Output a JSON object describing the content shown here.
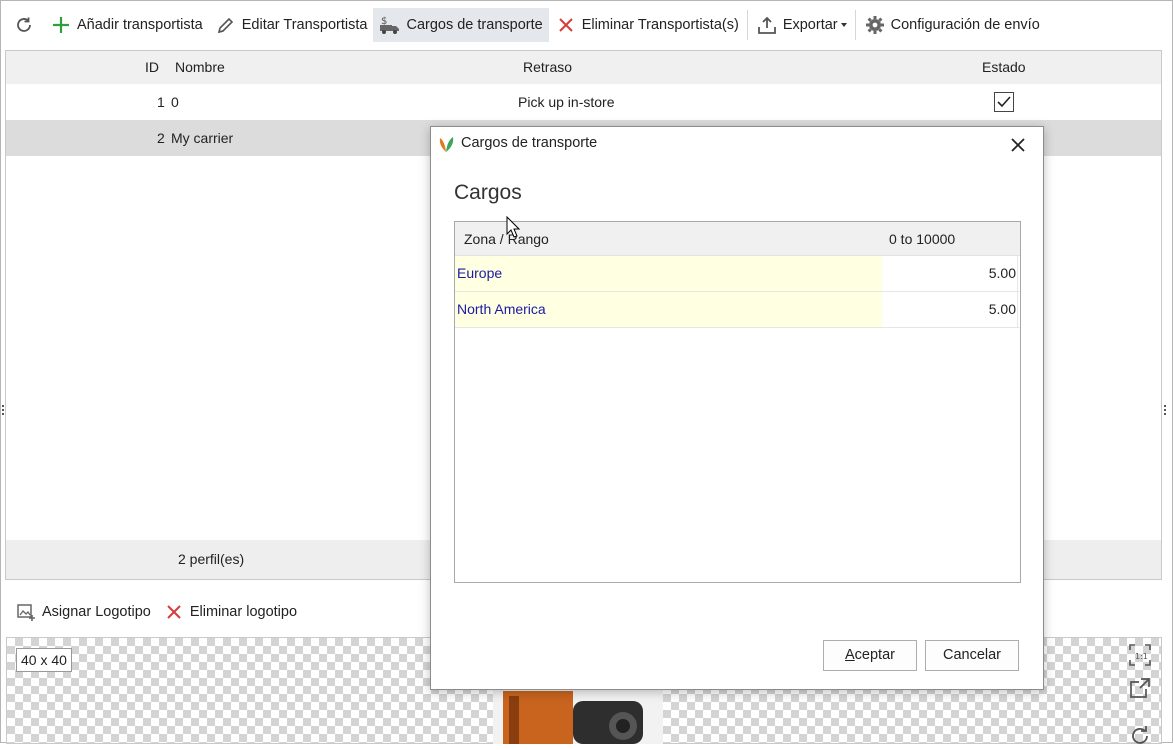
{
  "toolbar": {
    "items": [
      {
        "label": "",
        "icon": "refresh-icon"
      },
      {
        "label": "Añadir transportista",
        "icon": "plus-icon"
      },
      {
        "label": "Editar Transportista",
        "icon": "pencil-icon"
      },
      {
        "label": "Cargos de transporte",
        "icon": "shipping-charges-icon",
        "active": true
      },
      {
        "label": "Eliminar Transportista(s)",
        "icon": "close-icon"
      },
      {
        "label": "Exportar",
        "icon": "export-icon"
      },
      {
        "label": "Configuración de envío",
        "icon": "gear-icon"
      }
    ]
  },
  "grid": {
    "columns": {
      "id": "ID",
      "nombre": "Nombre",
      "retraso": "Retraso",
      "estado": "Estado"
    },
    "rows": [
      {
        "id": "1",
        "nombre": "0",
        "retraso": "Pick up in-store",
        "estado": true
      },
      {
        "id": "2",
        "nombre": "My carrier",
        "retraso": "",
        "estado": null
      }
    ],
    "footer": "2 perfil(es)"
  },
  "logo_bar": {
    "assign": "Asignar Logotipo",
    "remove": "Eliminar logotipo"
  },
  "preview": {
    "size": "40 x 40"
  },
  "dialog": {
    "title": "Cargos de transporte",
    "heading": "Cargos",
    "table": {
      "col_zone": "Zona / Rango",
      "col_range": "0 to 10000",
      "rows": [
        {
          "zone": "Europe",
          "value": "5.00"
        },
        {
          "zone": "North America",
          "value": "5.00"
        }
      ]
    },
    "ok_label_mnemonic": "A",
    "ok_label_rest": "ceptar",
    "cancel_label": "Cancelar"
  },
  "colors": {
    "accent_green": "#2e9e3e",
    "danger_red": "#d93a3a",
    "zone_highlight": "#ffffe1",
    "zone_text": "#1a1aa6"
  }
}
